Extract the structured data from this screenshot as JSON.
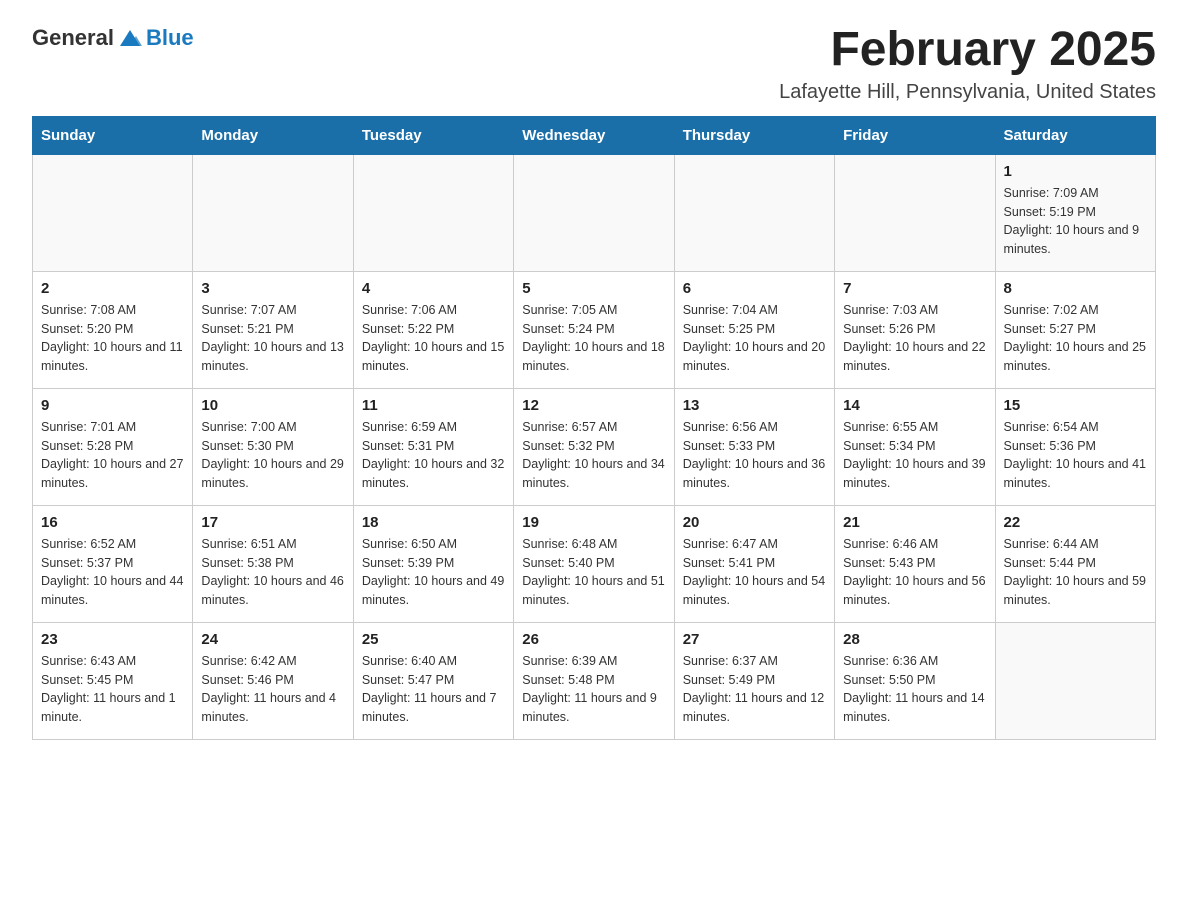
{
  "header": {
    "logo_text_general": "General",
    "logo_text_blue": "Blue",
    "month_title": "February 2025",
    "location": "Lafayette Hill, Pennsylvania, United States"
  },
  "days_of_week": [
    "Sunday",
    "Monday",
    "Tuesday",
    "Wednesday",
    "Thursday",
    "Friday",
    "Saturday"
  ],
  "weeks": [
    [
      {
        "day": "",
        "sunrise": "",
        "sunset": "",
        "daylight": ""
      },
      {
        "day": "",
        "sunrise": "",
        "sunset": "",
        "daylight": ""
      },
      {
        "day": "",
        "sunrise": "",
        "sunset": "",
        "daylight": ""
      },
      {
        "day": "",
        "sunrise": "",
        "sunset": "",
        "daylight": ""
      },
      {
        "day": "",
        "sunrise": "",
        "sunset": "",
        "daylight": ""
      },
      {
        "day": "",
        "sunrise": "",
        "sunset": "",
        "daylight": ""
      },
      {
        "day": "1",
        "sunrise": "Sunrise: 7:09 AM",
        "sunset": "Sunset: 5:19 PM",
        "daylight": "Daylight: 10 hours and 9 minutes."
      }
    ],
    [
      {
        "day": "2",
        "sunrise": "Sunrise: 7:08 AM",
        "sunset": "Sunset: 5:20 PM",
        "daylight": "Daylight: 10 hours and 11 minutes."
      },
      {
        "day": "3",
        "sunrise": "Sunrise: 7:07 AM",
        "sunset": "Sunset: 5:21 PM",
        "daylight": "Daylight: 10 hours and 13 minutes."
      },
      {
        "day": "4",
        "sunrise": "Sunrise: 7:06 AM",
        "sunset": "Sunset: 5:22 PM",
        "daylight": "Daylight: 10 hours and 15 minutes."
      },
      {
        "day": "5",
        "sunrise": "Sunrise: 7:05 AM",
        "sunset": "Sunset: 5:24 PM",
        "daylight": "Daylight: 10 hours and 18 minutes."
      },
      {
        "day": "6",
        "sunrise": "Sunrise: 7:04 AM",
        "sunset": "Sunset: 5:25 PM",
        "daylight": "Daylight: 10 hours and 20 minutes."
      },
      {
        "day": "7",
        "sunrise": "Sunrise: 7:03 AM",
        "sunset": "Sunset: 5:26 PM",
        "daylight": "Daylight: 10 hours and 22 minutes."
      },
      {
        "day": "8",
        "sunrise": "Sunrise: 7:02 AM",
        "sunset": "Sunset: 5:27 PM",
        "daylight": "Daylight: 10 hours and 25 minutes."
      }
    ],
    [
      {
        "day": "9",
        "sunrise": "Sunrise: 7:01 AM",
        "sunset": "Sunset: 5:28 PM",
        "daylight": "Daylight: 10 hours and 27 minutes."
      },
      {
        "day": "10",
        "sunrise": "Sunrise: 7:00 AM",
        "sunset": "Sunset: 5:30 PM",
        "daylight": "Daylight: 10 hours and 29 minutes."
      },
      {
        "day": "11",
        "sunrise": "Sunrise: 6:59 AM",
        "sunset": "Sunset: 5:31 PM",
        "daylight": "Daylight: 10 hours and 32 minutes."
      },
      {
        "day": "12",
        "sunrise": "Sunrise: 6:57 AM",
        "sunset": "Sunset: 5:32 PM",
        "daylight": "Daylight: 10 hours and 34 minutes."
      },
      {
        "day": "13",
        "sunrise": "Sunrise: 6:56 AM",
        "sunset": "Sunset: 5:33 PM",
        "daylight": "Daylight: 10 hours and 36 minutes."
      },
      {
        "day": "14",
        "sunrise": "Sunrise: 6:55 AM",
        "sunset": "Sunset: 5:34 PM",
        "daylight": "Daylight: 10 hours and 39 minutes."
      },
      {
        "day": "15",
        "sunrise": "Sunrise: 6:54 AM",
        "sunset": "Sunset: 5:36 PM",
        "daylight": "Daylight: 10 hours and 41 minutes."
      }
    ],
    [
      {
        "day": "16",
        "sunrise": "Sunrise: 6:52 AM",
        "sunset": "Sunset: 5:37 PM",
        "daylight": "Daylight: 10 hours and 44 minutes."
      },
      {
        "day": "17",
        "sunrise": "Sunrise: 6:51 AM",
        "sunset": "Sunset: 5:38 PM",
        "daylight": "Daylight: 10 hours and 46 minutes."
      },
      {
        "day": "18",
        "sunrise": "Sunrise: 6:50 AM",
        "sunset": "Sunset: 5:39 PM",
        "daylight": "Daylight: 10 hours and 49 minutes."
      },
      {
        "day": "19",
        "sunrise": "Sunrise: 6:48 AM",
        "sunset": "Sunset: 5:40 PM",
        "daylight": "Daylight: 10 hours and 51 minutes."
      },
      {
        "day": "20",
        "sunrise": "Sunrise: 6:47 AM",
        "sunset": "Sunset: 5:41 PM",
        "daylight": "Daylight: 10 hours and 54 minutes."
      },
      {
        "day": "21",
        "sunrise": "Sunrise: 6:46 AM",
        "sunset": "Sunset: 5:43 PM",
        "daylight": "Daylight: 10 hours and 56 minutes."
      },
      {
        "day": "22",
        "sunrise": "Sunrise: 6:44 AM",
        "sunset": "Sunset: 5:44 PM",
        "daylight": "Daylight: 10 hours and 59 minutes."
      }
    ],
    [
      {
        "day": "23",
        "sunrise": "Sunrise: 6:43 AM",
        "sunset": "Sunset: 5:45 PM",
        "daylight": "Daylight: 11 hours and 1 minute."
      },
      {
        "day": "24",
        "sunrise": "Sunrise: 6:42 AM",
        "sunset": "Sunset: 5:46 PM",
        "daylight": "Daylight: 11 hours and 4 minutes."
      },
      {
        "day": "25",
        "sunrise": "Sunrise: 6:40 AM",
        "sunset": "Sunset: 5:47 PM",
        "daylight": "Daylight: 11 hours and 7 minutes."
      },
      {
        "day": "26",
        "sunrise": "Sunrise: 6:39 AM",
        "sunset": "Sunset: 5:48 PM",
        "daylight": "Daylight: 11 hours and 9 minutes."
      },
      {
        "day": "27",
        "sunrise": "Sunrise: 6:37 AM",
        "sunset": "Sunset: 5:49 PM",
        "daylight": "Daylight: 11 hours and 12 minutes."
      },
      {
        "day": "28",
        "sunrise": "Sunrise: 6:36 AM",
        "sunset": "Sunset: 5:50 PM",
        "daylight": "Daylight: 11 hours and 14 minutes."
      },
      {
        "day": "",
        "sunrise": "",
        "sunset": "",
        "daylight": ""
      }
    ]
  ]
}
